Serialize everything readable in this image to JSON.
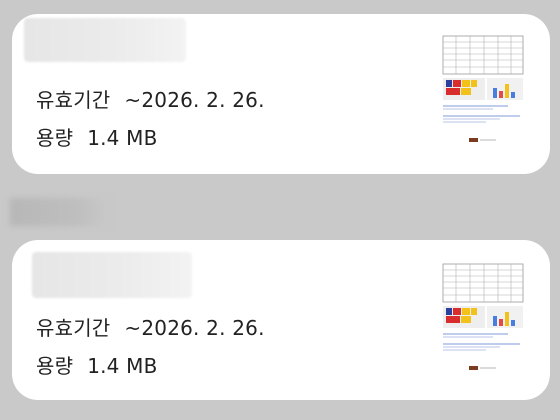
{
  "items": [
    {
      "validity_label": "유효기간",
      "validity_value": "~2026. 2. 26.",
      "size_label": "용량",
      "size_value": "1.4 MB"
    },
    {
      "validity_label": "유효기간",
      "validity_value": "~2026. 2. 26.",
      "size_label": "용량",
      "size_value": "1.4 MB"
    }
  ],
  "colors": {
    "background": "#c9c9c9",
    "card": "#ffffff",
    "text": "#222222"
  },
  "icons": {
    "thumbnail": "document-thumbnail-icon"
  }
}
